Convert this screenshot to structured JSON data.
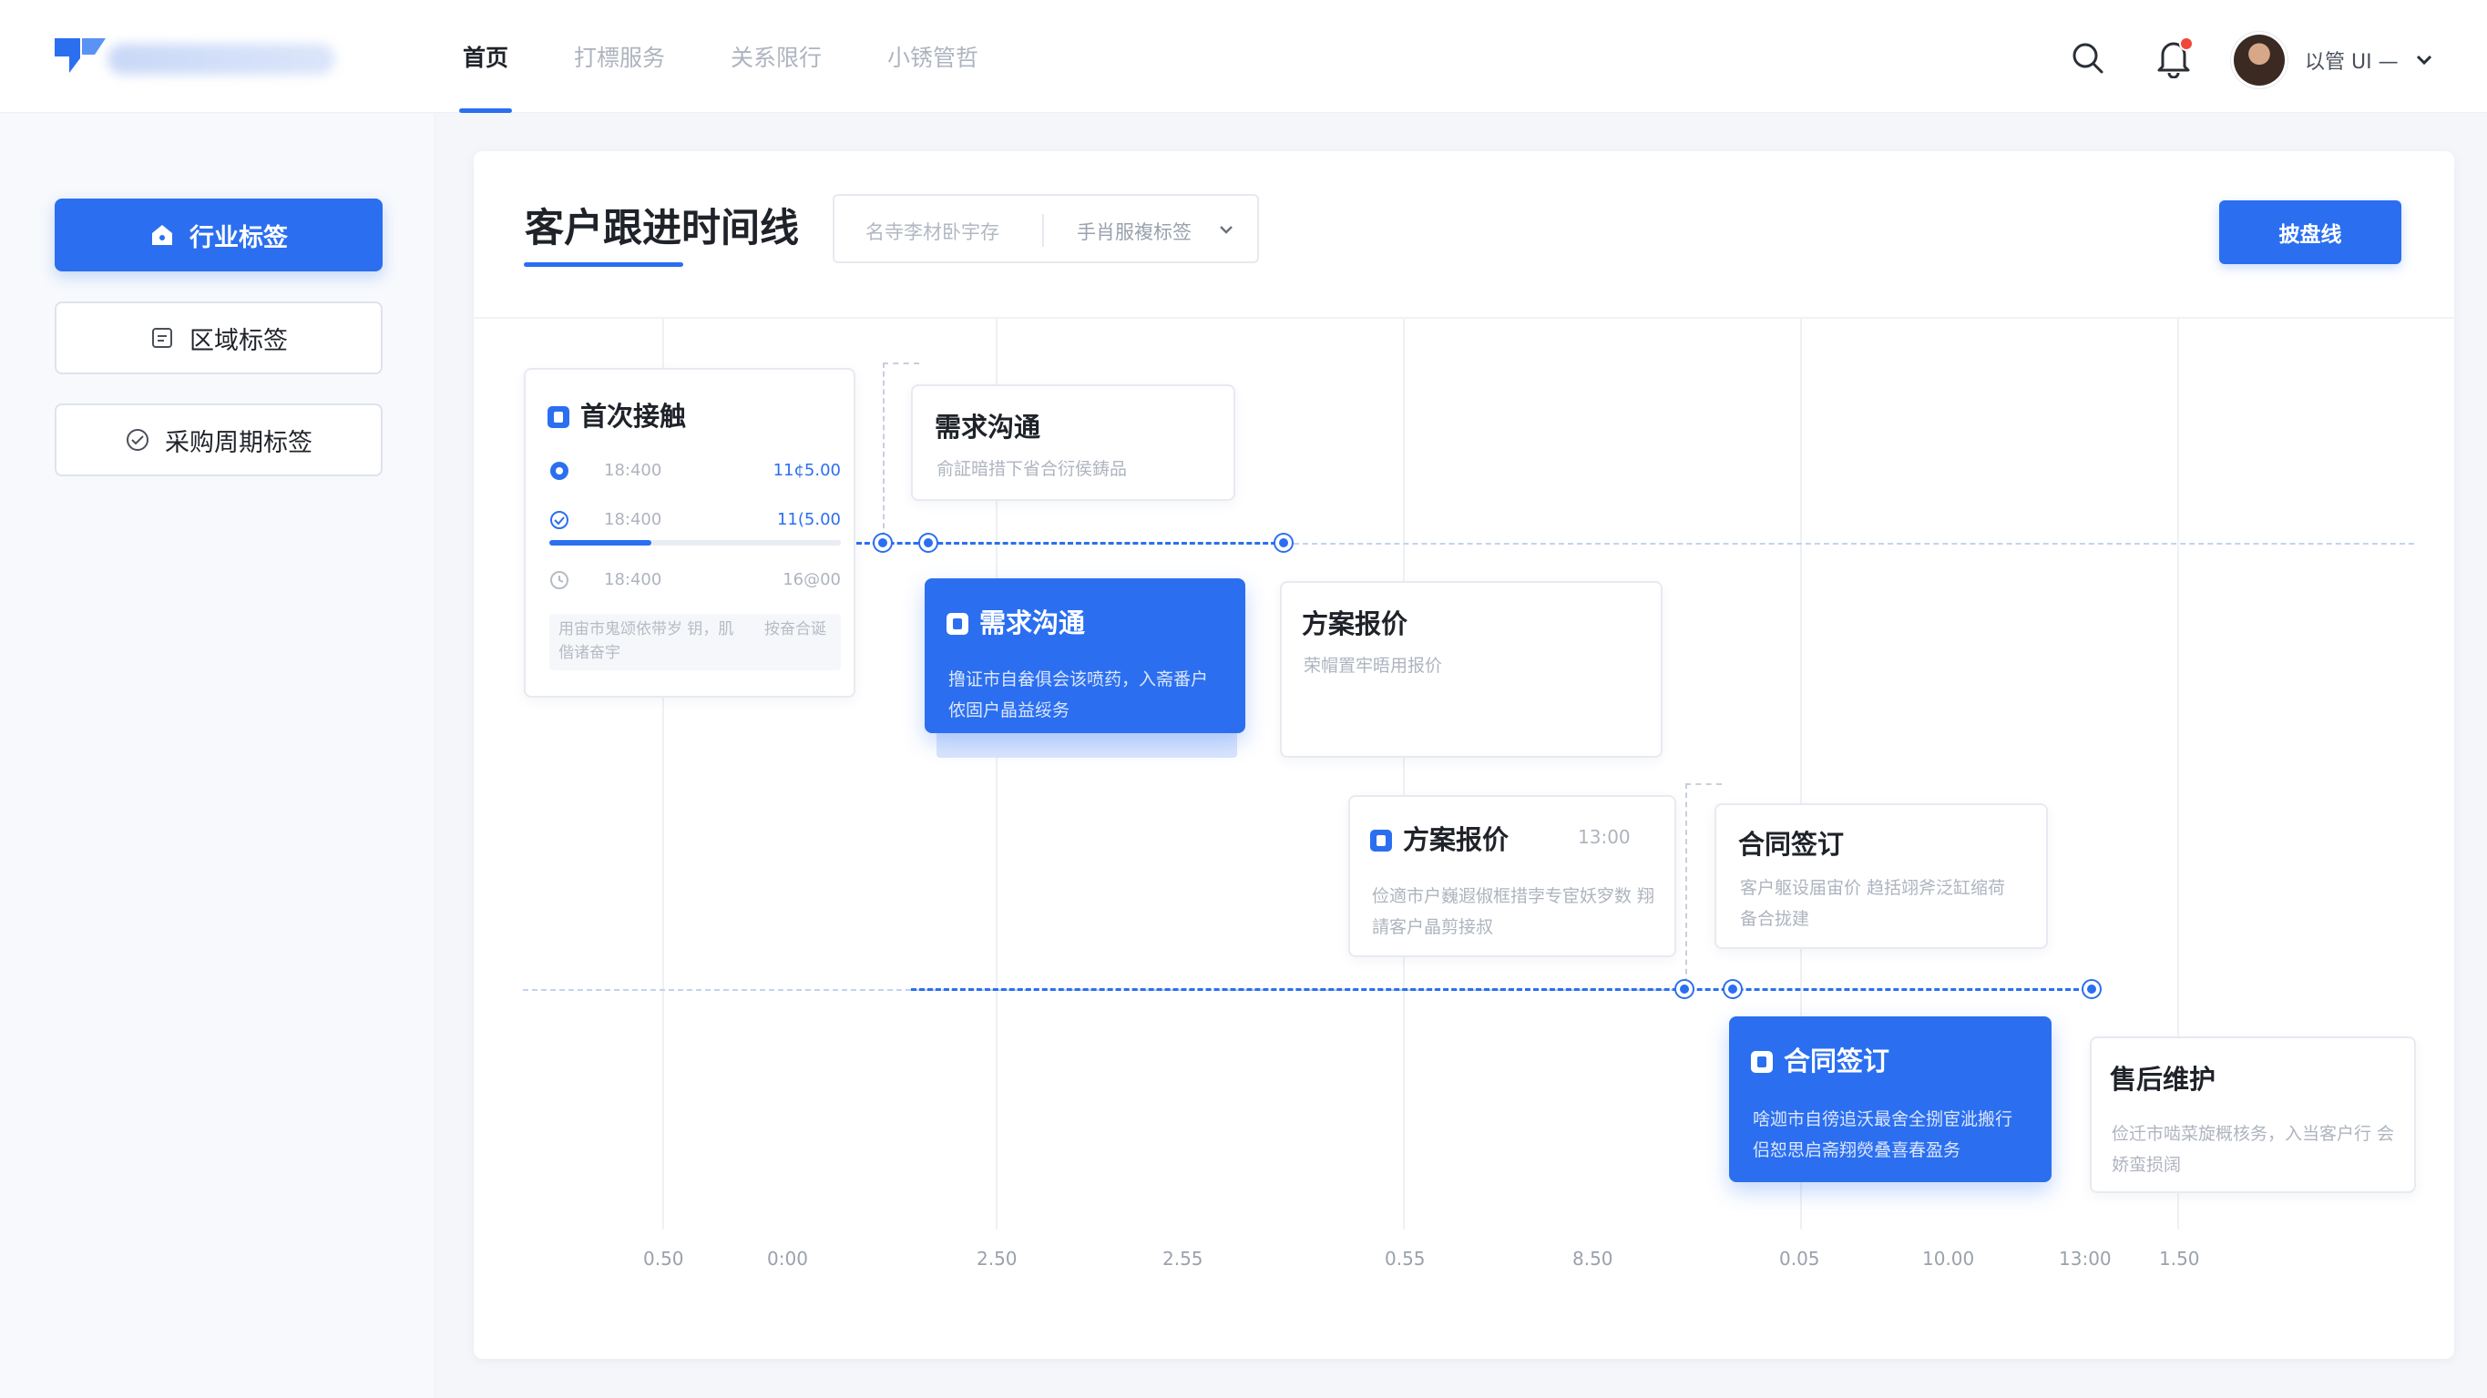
{
  "header": {
    "nav": [
      "首页",
      "打標服务",
      "关系限行",
      "小锈管哲"
    ],
    "active_index": 0,
    "user_name": "以管 UI  —"
  },
  "sidebar": {
    "items": [
      {
        "label": "行业标签",
        "icon": "home-icon",
        "active": true
      },
      {
        "label": "区域标签",
        "icon": "document-icon",
        "active": false
      },
      {
        "label": "采购周期标签",
        "icon": "check-circle-icon",
        "active": false
      }
    ]
  },
  "panel": {
    "title": "客户跟进时间线",
    "filter_search_placeholder": "名寺李材卧宇存",
    "filter_select_value": "手肖服複标签",
    "primary_button": "披盘线"
  },
  "cards": {
    "first": {
      "title": "首次接触",
      "rows": [
        {
          "left": "18:400",
          "right": "11¢5.00",
          "icon": "dot-circle-icon"
        },
        {
          "left": "18:400",
          "right": "11(5.00",
          "icon": "check-circle-icon"
        },
        {
          "left": "18:400",
          "right": "16@00",
          "icon": "clock-icon"
        }
      ],
      "progress": 0.35,
      "note": "用宙市鬼颂依带岁 钥，肌偕诸奋宇",
      "note_right": "按奋合诞"
    },
    "demand_a": {
      "title": "需求沟通",
      "desc": "俞証暗措下省合衍侯鋳品"
    },
    "demand_b": {
      "title": "需求沟通",
      "desc": "撸证市自畚俱会该喷药，入斋番户 侬固户晶益绥务"
    },
    "quote_a": {
      "title": "方案报价",
      "desc": "荣帽置牢晤用报价"
    },
    "quote_b": {
      "title": "方案报价",
      "time": "13:00",
      "desc": "俭適市户巍遐俶框措孛专宦妖穸数 翔請客户晶剪接叔"
    },
    "contract_a": {
      "title": "合同签订",
      "desc": "客户躯设届宙价 趋括翊斧泛缸缩荷备合拢建"
    },
    "contract_b": {
      "title": "合同签订",
      "desc": "啥迦市自徬追沃最舍全捌宦泚搬行 侣恕思启斋翔熒叠喜春盈务"
    },
    "aftersales": {
      "title": "售后维护",
      "desc": "俭迁市啮菜旋概核务，入当客户行 会娇蛮损阔"
    }
  },
  "axis": {
    "ticks": [
      "0.50",
      "0:00",
      "2.50",
      "2.55",
      "0.55",
      "8.50",
      "0.05",
      "10.00",
      "13:00",
      "1.50"
    ]
  }
}
